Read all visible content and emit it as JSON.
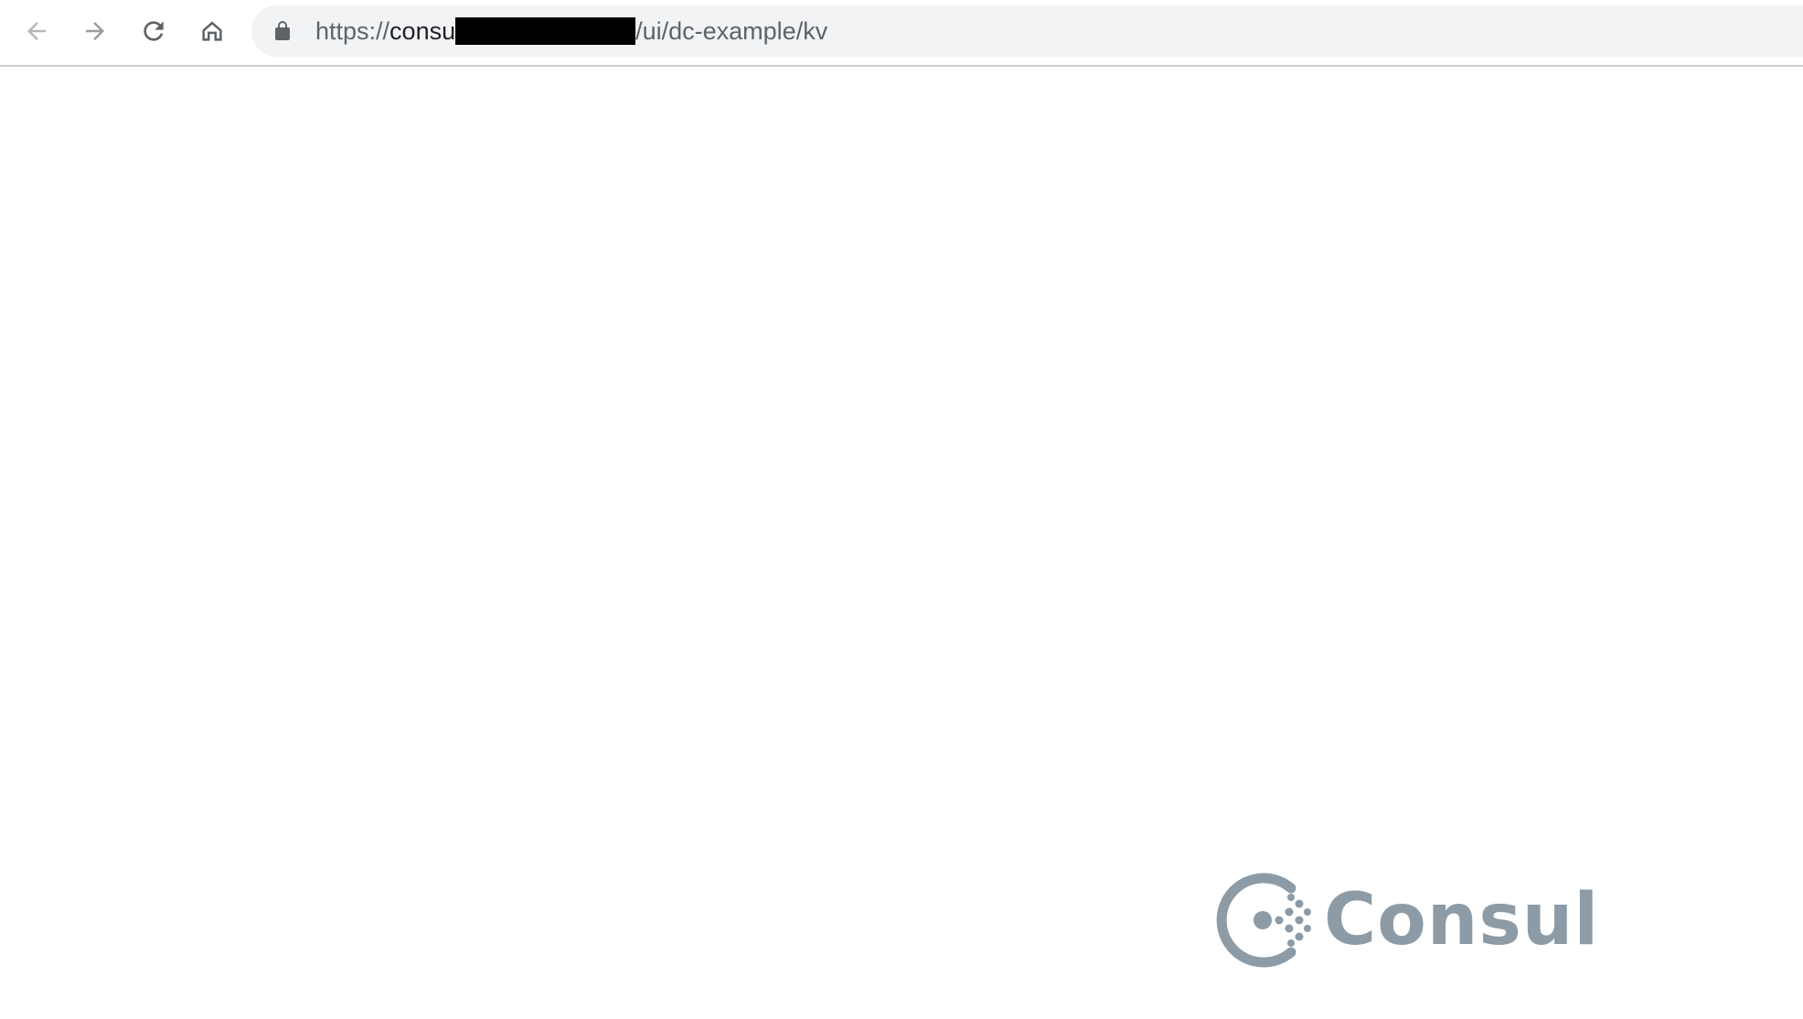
{
  "browser": {
    "url": {
      "scheme": "https://",
      "host_visible": "consu",
      "path": "/ui/dc-example/kv"
    },
    "icons": {
      "back": "back-arrow-icon",
      "forward": "forward-arrow-icon",
      "reload": "reload-icon",
      "home": "home-icon",
      "secure": "lock-icon"
    }
  },
  "page": {
    "logo_text": "Consul",
    "logo_color": "#8d9ba6"
  }
}
